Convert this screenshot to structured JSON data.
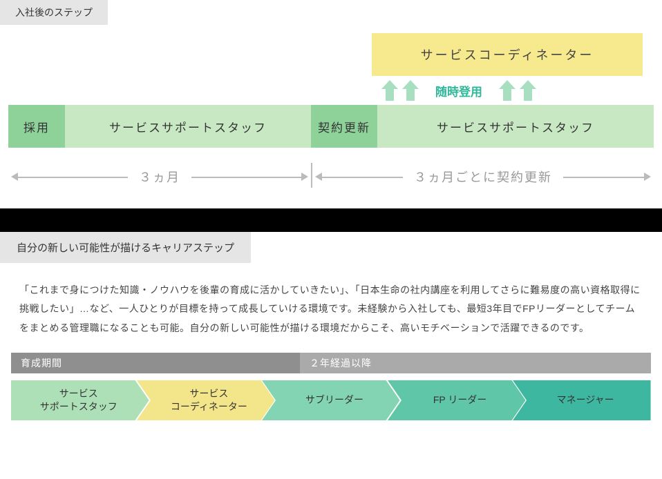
{
  "section1": {
    "tab": "入社後のステップ",
    "coordinator": "サービスコーディネーター",
    "promotion_label": "随時登用",
    "bar": {
      "adopt": "採用",
      "staff1": "サービスサポートスタッフ",
      "renew": "契約更新",
      "staff2": "サービスサポートスタッフ"
    },
    "timeline": {
      "left": "３ヵ月",
      "right": "３ヵ月ごとに契約更新"
    }
  },
  "section2": {
    "tab": "自分の新しい可能性が描けるキャリアステップ",
    "body": "「これまで身につけた知識・ノウハウを後輩の育成に活かしていきたい」、「日本生命の社内講座を利用してさらに難易度の高い資格取得に挑戦したい」…など、一人ひとりが目標を持って成長していける環境です。未経験から入社しても、最短3年目でFPリーダーとしてチームをまとめる管理職になることも可能。自分の新しい可能性が描ける環境だからこそ、高いモチベーションで活躍できるのです。",
    "periods": {
      "training": "育成期間",
      "after": "２年経過以降"
    },
    "career": [
      {
        "label": "サービス\nサポートスタッフ",
        "fill": "#aee0b8"
      },
      {
        "label": "サービス\nコーディネーター",
        "fill": "#f3e58a"
      },
      {
        "label": "サブリーダー",
        "fill": "#83d4b3"
      },
      {
        "label": "FP リーダー",
        "fill": "#5fc6a8"
      },
      {
        "label": "マネージャー",
        "fill": "#3eb7a0"
      }
    ]
  },
  "colors": {
    "arrow_green": "#a9dfc1"
  }
}
